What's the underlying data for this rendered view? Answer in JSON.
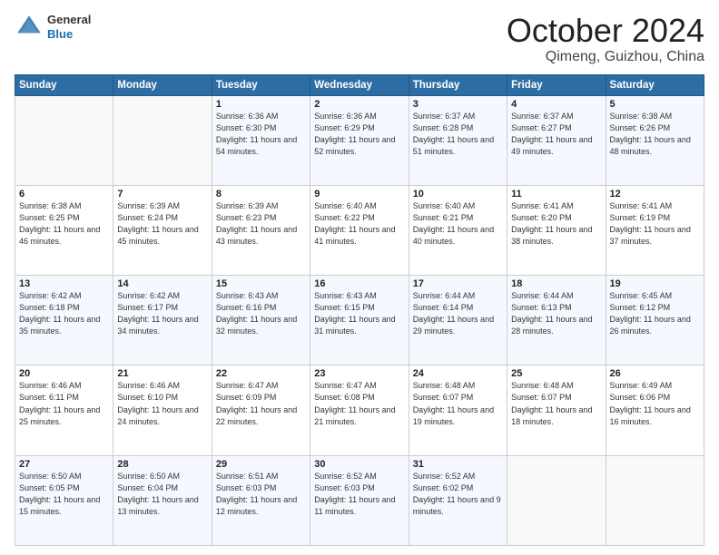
{
  "header": {
    "logo": {
      "general": "General",
      "blue": "Blue"
    },
    "month": "October 2024",
    "location": "Qimeng, Guizhou, China"
  },
  "weekdays": [
    "Sunday",
    "Monday",
    "Tuesday",
    "Wednesday",
    "Thursday",
    "Friday",
    "Saturday"
  ],
  "weeks": [
    [
      {
        "day": "",
        "sunrise": "",
        "sunset": "",
        "daylight": ""
      },
      {
        "day": "",
        "sunrise": "",
        "sunset": "",
        "daylight": ""
      },
      {
        "day": "1",
        "sunrise": "Sunrise: 6:36 AM",
        "sunset": "Sunset: 6:30 PM",
        "daylight": "Daylight: 11 hours and 54 minutes."
      },
      {
        "day": "2",
        "sunrise": "Sunrise: 6:36 AM",
        "sunset": "Sunset: 6:29 PM",
        "daylight": "Daylight: 11 hours and 52 minutes."
      },
      {
        "day": "3",
        "sunrise": "Sunrise: 6:37 AM",
        "sunset": "Sunset: 6:28 PM",
        "daylight": "Daylight: 11 hours and 51 minutes."
      },
      {
        "day": "4",
        "sunrise": "Sunrise: 6:37 AM",
        "sunset": "Sunset: 6:27 PM",
        "daylight": "Daylight: 11 hours and 49 minutes."
      },
      {
        "day": "5",
        "sunrise": "Sunrise: 6:38 AM",
        "sunset": "Sunset: 6:26 PM",
        "daylight": "Daylight: 11 hours and 48 minutes."
      }
    ],
    [
      {
        "day": "6",
        "sunrise": "Sunrise: 6:38 AM",
        "sunset": "Sunset: 6:25 PM",
        "daylight": "Daylight: 11 hours and 46 minutes."
      },
      {
        "day": "7",
        "sunrise": "Sunrise: 6:39 AM",
        "sunset": "Sunset: 6:24 PM",
        "daylight": "Daylight: 11 hours and 45 minutes."
      },
      {
        "day": "8",
        "sunrise": "Sunrise: 6:39 AM",
        "sunset": "Sunset: 6:23 PM",
        "daylight": "Daylight: 11 hours and 43 minutes."
      },
      {
        "day": "9",
        "sunrise": "Sunrise: 6:40 AM",
        "sunset": "Sunset: 6:22 PM",
        "daylight": "Daylight: 11 hours and 41 minutes."
      },
      {
        "day": "10",
        "sunrise": "Sunrise: 6:40 AM",
        "sunset": "Sunset: 6:21 PM",
        "daylight": "Daylight: 11 hours and 40 minutes."
      },
      {
        "day": "11",
        "sunrise": "Sunrise: 6:41 AM",
        "sunset": "Sunset: 6:20 PM",
        "daylight": "Daylight: 11 hours and 38 minutes."
      },
      {
        "day": "12",
        "sunrise": "Sunrise: 6:41 AM",
        "sunset": "Sunset: 6:19 PM",
        "daylight": "Daylight: 11 hours and 37 minutes."
      }
    ],
    [
      {
        "day": "13",
        "sunrise": "Sunrise: 6:42 AM",
        "sunset": "Sunset: 6:18 PM",
        "daylight": "Daylight: 11 hours and 35 minutes."
      },
      {
        "day": "14",
        "sunrise": "Sunrise: 6:42 AM",
        "sunset": "Sunset: 6:17 PM",
        "daylight": "Daylight: 11 hours and 34 minutes."
      },
      {
        "day": "15",
        "sunrise": "Sunrise: 6:43 AM",
        "sunset": "Sunset: 6:16 PM",
        "daylight": "Daylight: 11 hours and 32 minutes."
      },
      {
        "day": "16",
        "sunrise": "Sunrise: 6:43 AM",
        "sunset": "Sunset: 6:15 PM",
        "daylight": "Daylight: 11 hours and 31 minutes."
      },
      {
        "day": "17",
        "sunrise": "Sunrise: 6:44 AM",
        "sunset": "Sunset: 6:14 PM",
        "daylight": "Daylight: 11 hours and 29 minutes."
      },
      {
        "day": "18",
        "sunrise": "Sunrise: 6:44 AM",
        "sunset": "Sunset: 6:13 PM",
        "daylight": "Daylight: 11 hours and 28 minutes."
      },
      {
        "day": "19",
        "sunrise": "Sunrise: 6:45 AM",
        "sunset": "Sunset: 6:12 PM",
        "daylight": "Daylight: 11 hours and 26 minutes."
      }
    ],
    [
      {
        "day": "20",
        "sunrise": "Sunrise: 6:46 AM",
        "sunset": "Sunset: 6:11 PM",
        "daylight": "Daylight: 11 hours and 25 minutes."
      },
      {
        "day": "21",
        "sunrise": "Sunrise: 6:46 AM",
        "sunset": "Sunset: 6:10 PM",
        "daylight": "Daylight: 11 hours and 24 minutes."
      },
      {
        "day": "22",
        "sunrise": "Sunrise: 6:47 AM",
        "sunset": "Sunset: 6:09 PM",
        "daylight": "Daylight: 11 hours and 22 minutes."
      },
      {
        "day": "23",
        "sunrise": "Sunrise: 6:47 AM",
        "sunset": "Sunset: 6:08 PM",
        "daylight": "Daylight: 11 hours and 21 minutes."
      },
      {
        "day": "24",
        "sunrise": "Sunrise: 6:48 AM",
        "sunset": "Sunset: 6:07 PM",
        "daylight": "Daylight: 11 hours and 19 minutes."
      },
      {
        "day": "25",
        "sunrise": "Sunrise: 6:48 AM",
        "sunset": "Sunset: 6:07 PM",
        "daylight": "Daylight: 11 hours and 18 minutes."
      },
      {
        "day": "26",
        "sunrise": "Sunrise: 6:49 AM",
        "sunset": "Sunset: 6:06 PM",
        "daylight": "Daylight: 11 hours and 16 minutes."
      }
    ],
    [
      {
        "day": "27",
        "sunrise": "Sunrise: 6:50 AM",
        "sunset": "Sunset: 6:05 PM",
        "daylight": "Daylight: 11 hours and 15 minutes."
      },
      {
        "day": "28",
        "sunrise": "Sunrise: 6:50 AM",
        "sunset": "Sunset: 6:04 PM",
        "daylight": "Daylight: 11 hours and 13 minutes."
      },
      {
        "day": "29",
        "sunrise": "Sunrise: 6:51 AM",
        "sunset": "Sunset: 6:03 PM",
        "daylight": "Daylight: 11 hours and 12 minutes."
      },
      {
        "day": "30",
        "sunrise": "Sunrise: 6:52 AM",
        "sunset": "Sunset: 6:03 PM",
        "daylight": "Daylight: 11 hours and 11 minutes."
      },
      {
        "day": "31",
        "sunrise": "Sunrise: 6:52 AM",
        "sunset": "Sunset: 6:02 PM",
        "daylight": "Daylight: 11 hours and 9 minutes."
      },
      {
        "day": "",
        "sunrise": "",
        "sunset": "",
        "daylight": ""
      },
      {
        "day": "",
        "sunrise": "",
        "sunset": "",
        "daylight": ""
      }
    ]
  ]
}
